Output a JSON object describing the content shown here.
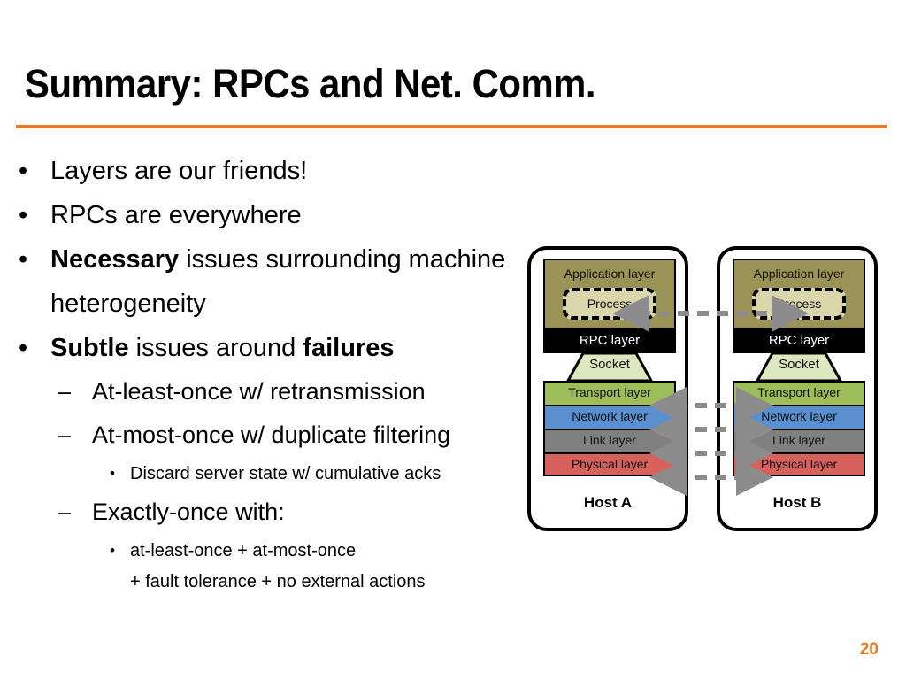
{
  "slide": {
    "title": "Summary: RPCs and Net. Comm.",
    "page_number": "20",
    "accent_color": "#E8792A"
  },
  "bullets": {
    "b1": "Layers are our friends!",
    "b2": "RPCs are everywhere",
    "b3_bold": "Necessary",
    "b3_rest": " issues surrounding machine heterogeneity",
    "b4_bold1": "Subtle",
    "b4_mid": " issues around ",
    "b4_bold2": "failures",
    "s1": "At-least-once w/ retransmission",
    "s2": "At-most-once w/ duplicate filtering",
    "s2a": "Discard server state w/ cumulative acks",
    "s3": "Exactly-once with:",
    "s3a_line1": "at-least-once + at-most-once",
    "s3a_line2": "+ fault tolerance + no external actions",
    "marker_level1": "•",
    "marker_level2": "–",
    "marker_level3": "•"
  },
  "diagram": {
    "host_a": {
      "label": "Host A",
      "application_layer": "Application layer",
      "process": "Process",
      "rpc_layer": "RPC layer",
      "socket": "Socket",
      "transport_layer": "Transport layer",
      "network_layer": "Network layer",
      "link_layer": "Link layer",
      "physical_layer": "Physical layer"
    },
    "host_b": {
      "label": "Host B",
      "application_layer": "Application layer",
      "process": "Process",
      "rpc_layer": "RPC layer",
      "socket": "Socket",
      "transport_layer": "Transport layer",
      "network_layer": "Network layer",
      "link_layer": "Link layer",
      "physical_layer": "Physical layer"
    },
    "colors": {
      "application": "#9B9256",
      "process": "#DBD6AC",
      "rpc": "#000000",
      "socket": "#DCE8C0",
      "transport": "#9DBD5A",
      "network": "#5A8FD0",
      "link": "#808080",
      "physical": "#D9615C",
      "arrow": "#8C8C8C"
    }
  }
}
